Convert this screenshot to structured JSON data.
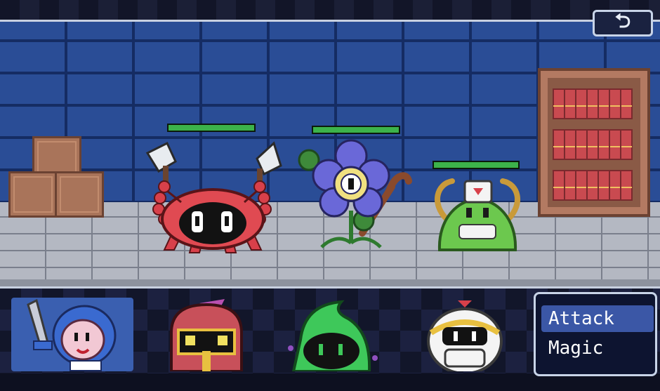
{
  "header": {
    "back_icon": "⮌"
  },
  "enemies": [
    {
      "name": "crab-enemy",
      "icon": "crab-with-axes-icon",
      "hp_fraction": 1.0
    },
    {
      "name": "flower-enemy",
      "icon": "purple-flower-icon",
      "hp_fraction": 1.0
    },
    {
      "name": "slime-enemy",
      "icon": "green-slime-nurse-icon",
      "hp_fraction": 1.0
    }
  ],
  "party": [
    {
      "name": "knight-hero",
      "icon": "blue-knight-with-sword-icon",
      "active": true
    },
    {
      "name": "armored-hero",
      "icon": "red-helmet-knight-icon",
      "active": false
    },
    {
      "name": "mage-hero",
      "icon": "green-hooded-mage-icon",
      "active": false
    },
    {
      "name": "cleric-hero",
      "icon": "white-masked-cleric-icon",
      "active": false
    }
  ],
  "command_menu": {
    "items": [
      "Attack",
      "Magic",
      ""
    ],
    "selected_index": 0
  },
  "colors": {
    "hp_green": "#3cb34a",
    "menu_selected": "#3b57a6",
    "wall_blue": "#2a4d96"
  }
}
